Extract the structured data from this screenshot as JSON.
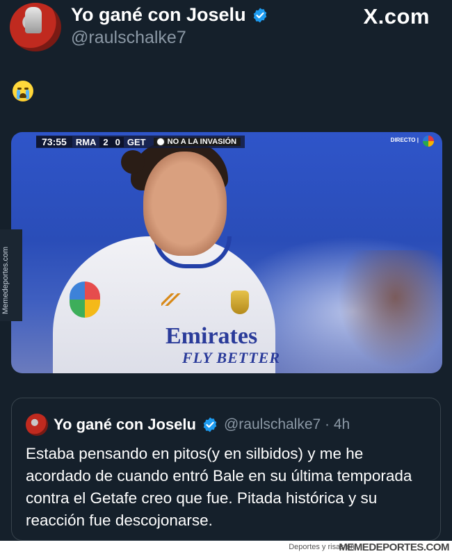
{
  "tweet": {
    "display_name": "Yo gané con Joselu",
    "handle": "@raulschalke7",
    "site": "X.com",
    "body_emoji": "loudly-crying-face",
    "verified": true
  },
  "media": {
    "scorebug": {
      "time": "73:55",
      "home": "RMA",
      "score_home": "2",
      "score_away": "0",
      "away": "GET",
      "message": "NO A LA INVASIÓN"
    },
    "live_label": "DIRECTO |",
    "shirt_sponsor": "Emirates",
    "shirt_sponsor_sub": "FLY BETTER",
    "side_watermark": "Memedeportes.com"
  },
  "quoted_tweet": {
    "display_name": "Yo gané con Joselu",
    "handle_time": "@raulschalke7 · 4h",
    "text": "Estaba pensando en pitos(y en silbidos) y me he acordado de cuando entró Bale en su última temporada contra el Getafe creo que fue. Pitada histórica y su reacción fue descojonarse."
  },
  "footer": {
    "tagline": "Deportes y risas en",
    "brand": "MEMEDEPORTES.COM"
  },
  "colors": {
    "background": "#15202b",
    "verified": "#1d9bf0",
    "muted": "#8b98a5",
    "border": "#38444d"
  }
}
